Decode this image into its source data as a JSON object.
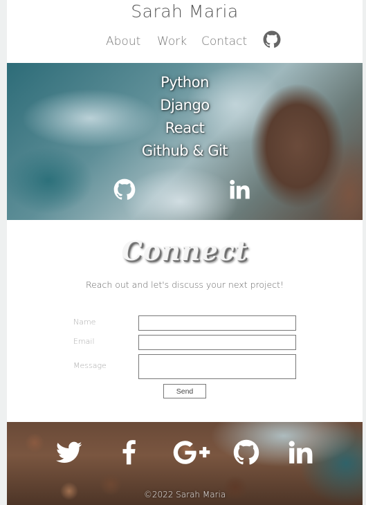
{
  "header": {
    "title": "Sarah Maria",
    "nav": [
      {
        "label": "About"
      },
      {
        "label": "Work"
      },
      {
        "label": "Contact"
      }
    ],
    "nav_icon": "github-icon"
  },
  "hero": {
    "skills": [
      "Python",
      "Django",
      "React",
      "Github & Git"
    ],
    "icons": [
      "github-icon",
      "linkedin-icon"
    ]
  },
  "connect": {
    "title": "Connect",
    "subtitle": "Reach out and let's discuss your next project!",
    "form": {
      "name_label": "Name",
      "email_label": "Email",
      "message_label": "Message",
      "name_value": "",
      "email_value": "",
      "message_value": "",
      "send_label": "Send"
    }
  },
  "footer": {
    "icons": [
      "twitter-icon",
      "facebook-icon",
      "google-plus-icon",
      "github-icon",
      "linkedin-icon"
    ],
    "copyright": "©2022 Sarah Maria"
  },
  "colors": {
    "text_gray": "#777777",
    "white": "#ffffff"
  }
}
